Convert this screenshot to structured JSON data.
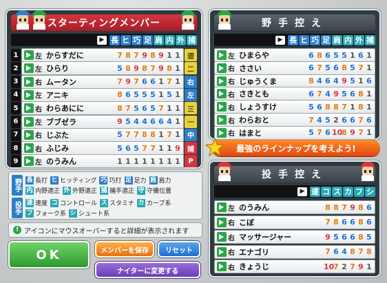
{
  "lineup": {
    "title": "スターティングメンバー",
    "stat_headers": [
      "長",
      "ヒ",
      "巧",
      "足",
      "肩",
      "内",
      "外",
      "捕"
    ],
    "rows": [
      {
        "num": "1",
        "hand": "左",
        "name": "からすだに",
        "stats": [
          "7",
          "8",
          "7",
          "9",
          "8",
          "9",
          "1",
          "1"
        ],
        "pos": "遊",
        "pos_color": "#e8d23a"
      },
      {
        "num": "2",
        "hand": "左",
        "name": "ひらり",
        "stats": [
          "5",
          "8",
          "9",
          "8",
          "7",
          "9",
          "8",
          "1"
        ],
        "pos": "二",
        "pos_color": "#e8d23a"
      },
      {
        "num": "3",
        "hand": "右",
        "name": "ムータン",
        "stats": [
          "7",
          "9",
          "7",
          "6",
          "6",
          "1",
          "7",
          "1"
        ],
        "pos": "右",
        "pos_color": "#2d7fc8"
      },
      {
        "num": "4",
        "hand": "左",
        "name": "アニキ",
        "stats": [
          "8",
          "6",
          "5",
          "5",
          "5",
          "1",
          "5",
          "1"
        ],
        "pos": "左",
        "pos_color": "#2d7fc8"
      },
      {
        "num": "5",
        "hand": "右",
        "name": "わらあにに",
        "stats": [
          "8",
          "7",
          "5",
          "6",
          "5",
          "7",
          "1",
          "1"
        ],
        "pos": "三",
        "pos_color": "#e8d23a"
      },
      {
        "num": "6",
        "hand": "左",
        "name": "ブブゼラ",
        "stats": [
          "9",
          "5",
          "4",
          "4",
          "6",
          "6",
          "4",
          "1"
        ],
        "pos": "一",
        "pos_color": "#e8d23a"
      },
      {
        "num": "7",
        "hand": "右",
        "name": "じぶた",
        "stats": [
          "5",
          "7",
          "7",
          "8",
          "8",
          "1",
          "7",
          "1"
        ],
        "pos": "中",
        "pos_color": "#2d7fc8"
      },
      {
        "num": "8",
        "hand": "右",
        "name": "ふじみ",
        "stats": [
          "5",
          "6",
          "5",
          "7",
          "7",
          "1",
          "1",
          "9"
        ],
        "pos": "捕",
        "pos_color": "#d8343f"
      },
      {
        "num": "9",
        "hand": "左",
        "name": "のうみん",
        "stats": [
          "1",
          "1",
          "1",
          "1",
          "1",
          "1",
          "1",
          "1"
        ],
        "pos": "P",
        "pos_color": "#d8343f"
      }
    ]
  },
  "bench": {
    "title": "野手控え",
    "stat_headers": [
      "長",
      "ヒ",
      "巧",
      "足",
      "肩",
      "内",
      "外",
      "捕"
    ],
    "rows": [
      {
        "hand": "左",
        "name": "ひまらや",
        "stats": [
          "6",
          "8",
          "6",
          "5",
          "5",
          "1",
          "6",
          "1"
        ]
      },
      {
        "hand": "右",
        "name": "ささい",
        "stats": [
          "6",
          "7",
          "5",
          "6",
          "8",
          "5",
          "7",
          "1"
        ]
      },
      {
        "hand": "右",
        "name": "じゅうくま",
        "stats": [
          "8",
          "4",
          "6",
          "4",
          "9",
          "5",
          "1",
          "6"
        ]
      },
      {
        "hand": "右",
        "name": "さきとも",
        "stats": [
          "6",
          "7",
          "4",
          "9",
          "5",
          "6",
          "8",
          "1"
        ]
      },
      {
        "hand": "右",
        "name": "しょうすけ",
        "stats": [
          "5",
          "6",
          "8",
          "8",
          "7",
          "1",
          "8",
          "1"
        ]
      },
      {
        "hand": "右",
        "name": "わらおと",
        "stats": [
          "7",
          "4",
          "5",
          "2",
          "6",
          "6",
          "7",
          "6"
        ]
      },
      {
        "hand": "右",
        "name": "はまと",
        "stats": [
          "5",
          "7",
          "6",
          "10",
          "8",
          "9",
          "7",
          "1"
        ]
      }
    ]
  },
  "banner": "最強のラインナップを考えよう!",
  "pitchers": {
    "title": "投手控え",
    "stat_headers": [
      "速",
      "コ",
      "ス",
      "カ",
      "フ",
      "シ"
    ],
    "rows": [
      {
        "hand": "左",
        "name": "のうみん",
        "stats": [
          "8",
          "8",
          "7",
          "9",
          "8",
          "6"
        ]
      },
      {
        "hand": "右",
        "name": "こぼ",
        "stats": [
          "7",
          "8",
          "6",
          "6",
          "8",
          "6"
        ]
      },
      {
        "hand": "右",
        "name": "マッサージャー",
        "stats": [
          "9",
          "5",
          "6",
          "6",
          "8",
          "5"
        ]
      },
      {
        "hand": "右",
        "name": "エナゴリ",
        "stats": [
          "7",
          "6",
          "4",
          "8",
          "7",
          "8"
        ]
      },
      {
        "hand": "右",
        "name": "きょうじ",
        "stats": [
          "10",
          "7",
          "2",
          "7",
          "9",
          "1"
        ]
      }
    ]
  },
  "legend": {
    "fielder_side": "野手",
    "pitcher_side": "投手",
    "fielder_row1": [
      {
        "tag": "長",
        "text": "長打",
        "color": "#2d7fc8"
      },
      {
        "tag": "ヒ",
        "text": "ヒッティング",
        "color": "#2d7fc8"
      },
      {
        "tag": "巧",
        "text": "巧打",
        "color": "#2d7fc8"
      },
      {
        "tag": "足",
        "text": "足力",
        "color": "#2d7fc8"
      },
      {
        "tag": "肩",
        "text": "肩力",
        "color": "#2d7fc8"
      }
    ],
    "fielder_row2": [
      {
        "tag": "内",
        "text": "内野適正",
        "color": "#27a7b8"
      },
      {
        "tag": "外",
        "text": "外野適正",
        "color": "#27a7b8"
      },
      {
        "tag": "捕",
        "text": "捕手適正",
        "color": "#27a7b8"
      },
      {
        "tag": "守",
        "text": "守備位置",
        "color": "#27a7b8"
      }
    ],
    "pitcher_row1": [
      {
        "tag": "速",
        "text": "速度",
        "color": "#27a7b8"
      },
      {
        "tag": "コ",
        "text": "コントロール",
        "color": "#27a7b8"
      },
      {
        "tag": "ス",
        "text": "スタミナ",
        "color": "#27a7b8"
      },
      {
        "tag": "カ",
        "text": "カーブ系",
        "color": "#27a7b8"
      }
    ],
    "pitcher_row2": [
      {
        "tag": "フ",
        "text": "フォーク系",
        "color": "#27a7b8"
      },
      {
        "tag": "シ",
        "text": "シュート系",
        "color": "#27a7b8"
      }
    ]
  },
  "hint": "アイコンにマウスオーバーすると詳細が表示されます",
  "buttons": {
    "ok": "OK",
    "save": "メンバーを保存",
    "reset": "リセット",
    "night": "ナイターに変更する"
  },
  "colors": {
    "stat_red": "#d8343f",
    "stat_orange": "#e07a12",
    "stat_blue": "#1e6fd1",
    "stat_gray": "#555555",
    "stat_cyan": "#27a7b8"
  }
}
